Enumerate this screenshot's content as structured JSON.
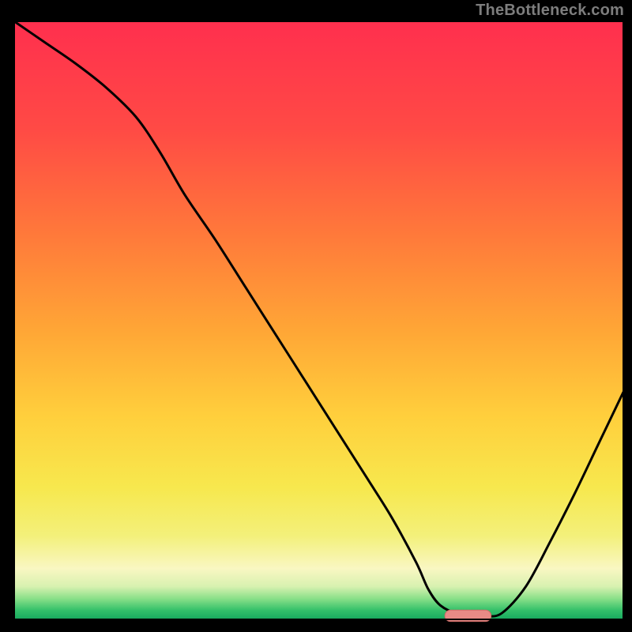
{
  "watermark": {
    "text": "TheBottleneck.com"
  },
  "colors": {
    "frame": "#000000",
    "curve": "#000000",
    "marker_fill": "#e88a86",
    "marker_stroke": "#cf6b66",
    "gradient_stops": [
      {
        "offset": 0.0,
        "color": "#ff2f4e"
      },
      {
        "offset": 0.18,
        "color": "#ff4a45"
      },
      {
        "offset": 0.36,
        "color": "#ff7a3a"
      },
      {
        "offset": 0.52,
        "color": "#ffa736"
      },
      {
        "offset": 0.66,
        "color": "#ffcf3c"
      },
      {
        "offset": 0.78,
        "color": "#f7e84e"
      },
      {
        "offset": 0.86,
        "color": "#f3f07a"
      },
      {
        "offset": 0.915,
        "color": "#f9f7c2"
      },
      {
        "offset": 0.945,
        "color": "#d8f1b0"
      },
      {
        "offset": 0.965,
        "color": "#8be089"
      },
      {
        "offset": 0.985,
        "color": "#33c06a"
      },
      {
        "offset": 1.0,
        "color": "#17a85e"
      }
    ]
  },
  "chart_data": {
    "type": "line",
    "title": "",
    "xlabel": "",
    "ylabel": "",
    "xlim": [
      0,
      100
    ],
    "ylim": [
      0,
      100
    ],
    "x": [
      0,
      5,
      10,
      15,
      20,
      24,
      28,
      33,
      38,
      43,
      48,
      53,
      58,
      62,
      66,
      68,
      70,
      73,
      77,
      80,
      84,
      88,
      92,
      96,
      100
    ],
    "y": [
      100,
      96.5,
      93,
      89,
      84,
      78,
      71,
      63.5,
      55.5,
      47.5,
      39.5,
      31.5,
      23.5,
      17,
      9.5,
      5,
      2.3,
      0.9,
      0.6,
      1.0,
      5.5,
      13,
      21,
      29.5,
      38
    ],
    "marker": {
      "x_center": 74.5,
      "y": 0.6,
      "half_width": 3.8,
      "half_height": 0.95
    },
    "grid": false,
    "legend": null
  }
}
